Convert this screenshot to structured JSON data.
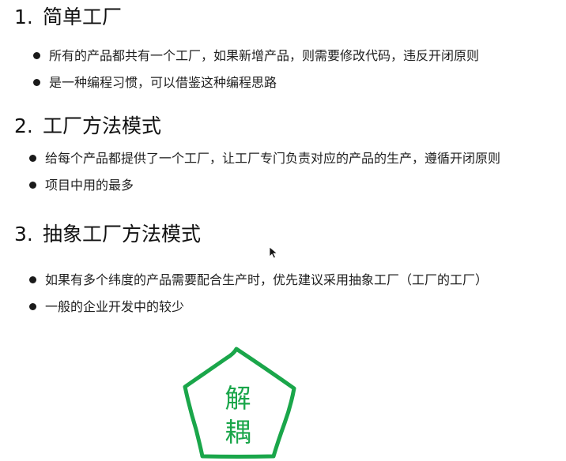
{
  "sections": [
    {
      "number": "1.",
      "title": "简单工厂",
      "bullets": [
        "所有的产品都共有一个工厂，如果新增产品，则需要修改代码，违反开闭原则",
        "是一种编程习惯，可以借鉴这种编程思路"
      ]
    },
    {
      "number": "2.",
      "title": "工厂方法模式",
      "bullets": [
        "给每个产品都提供了一个工厂，让工厂专门负责对应的产品的生产，遵循开闭原则",
        "项目中用的最多"
      ]
    },
    {
      "number": "3.",
      "title": "抽象工厂方法模式",
      "bullets": [
        "如果有多个纬度的产品需要配合生产时，优先建议采用抽象工厂（工厂的工厂）",
        "一般的企业开发中的较少"
      ]
    }
  ],
  "badge": {
    "char1": "解",
    "char2": "耦",
    "color": "#1aa64a"
  }
}
